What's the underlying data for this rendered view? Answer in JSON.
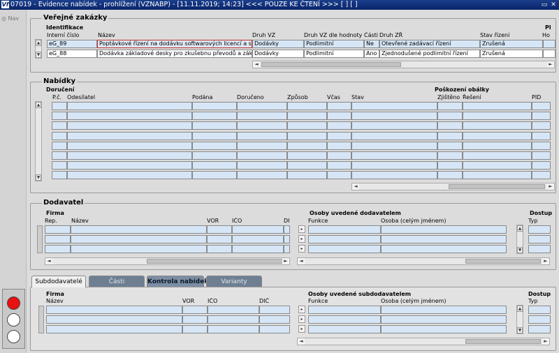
{
  "window": {
    "title": "07019 - Evidence nabídek - prohlížení (VZNABP) - [11.11.2019; 14:23] <<< POUZE KE ČTENÍ >>>  [ ]  [ ]",
    "icon_text": "Vf"
  },
  "nav": {
    "label": "Nav"
  },
  "verejne": {
    "title": "Veřejné zakázky",
    "subtitle": "Identifikace",
    "right_cut": "Pl",
    "headers": {
      "interni": "Interní číslo",
      "nazev": "Název",
      "druh_vz": "Druh VZ",
      "druh_vz_hodnota": "Druh VZ dle hodnoty",
      "casti": "Části",
      "druh_zr": "Druh ZŘ",
      "stav": "Stav řízení",
      "ho": "Ho"
    },
    "rows": [
      {
        "interni": "eG_89",
        "nazev": "Poptávkové řízení na dodávku softwarových licencí a souvis",
        "druh_vz": "Dodávky",
        "druh_vz_hodnota": "Podlimitní",
        "casti": "Ne",
        "druh_zr": "Otevřené zadávací řízení",
        "stav": "Zrušená"
      },
      {
        "interni": "eG_88",
        "nazev": "Dodávka základové desky pro zkušebnu převodů a základov",
        "druh_vz": "Dodávky",
        "druh_vz_hodnota": "Podlimitní",
        "casti": "Ano",
        "druh_zr": "Zjednodušené podlimitní řízení",
        "stav": "Zrušená"
      }
    ]
  },
  "nabidky": {
    "title": "Nabídky",
    "subtitle": "Doručení",
    "group_poskozeni": "Poškození obálky",
    "headers": {
      "pc": "P.č.",
      "odesilatel": "Odesílatel",
      "podana": "Podána",
      "doruceno": "Doručeno",
      "zpusob": "Způsob",
      "vcas": "Včas",
      "stav": "Stav",
      "zjisteno": "Zjištěno",
      "reseni": "Řešení",
      "pid": "PID"
    }
  },
  "dodavatel": {
    "title": "Dodavatel",
    "firma": "Firma",
    "osoby_title": "Osoby uvedené dodavatelem",
    "dostup": "Dostup",
    "headers": {
      "rep": "Rep.",
      "nazev": "Název",
      "vor": "VOR",
      "ico": "IČO",
      "di": "DI",
      "funkce": "Funkce",
      "osoba": "Osoba (celým jménem)",
      "typ": "Typ"
    }
  },
  "tabs": [
    {
      "label": "Subdodavatelé",
      "state": "active"
    },
    {
      "label": "Části",
      "state": "disabled"
    },
    {
      "label": "Kontrola nabídek",
      "state": "enabled"
    },
    {
      "label": "Varianty",
      "state": "disabled"
    }
  ],
  "subdodavatel": {
    "firma": "Firma",
    "osoby_title": "Osoby uvedené subdodavatelem",
    "dostup": "Dostup",
    "headers": {
      "nazev": "Název",
      "vor": "VOR",
      "ico": "IČO",
      "dic": "DIČ",
      "funkce": "Funkce",
      "osoba": "Osoba (celým jménem)",
      "typ": "Typ"
    }
  },
  "colors": {
    "titlebar": "#0a246a",
    "empty_cell": "#d6e6f6",
    "traffic_red": "#e81010",
    "traffic_off": "#ffffff",
    "tab_inactive": "#6e7f92"
  }
}
